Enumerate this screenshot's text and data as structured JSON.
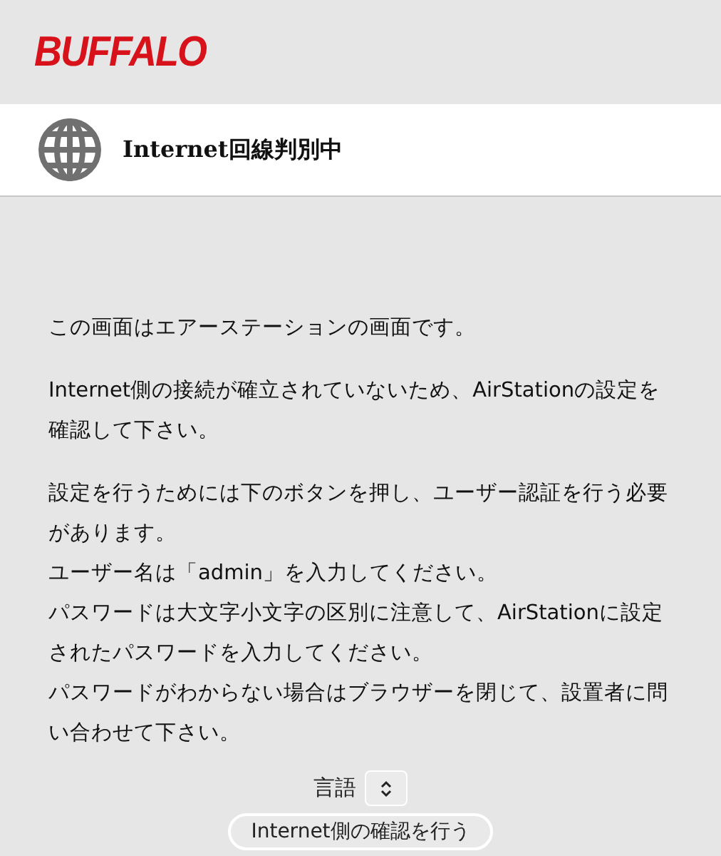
{
  "logo": "BUFFALO",
  "header": {
    "title": "Internet回線判別中"
  },
  "paragraphs": [
    [
      "この画面はエアーステーションの画面です。"
    ],
    [
      "Internet側の接続が確立されていないため、AirStationの設定を確認して下さい。"
    ],
    [
      "設定を行うためには下のボタンを押し、ユーザー認証を行う必要があります。",
      "ユーザー名は「admin」を入力してください。",
      "パスワードは大文字小文字の区別に注意して、AirStationに設定されたパスワードを入力してください。",
      "パスワードがわからない場合はブラウザーを閉じて、設置者に問い合わせて下さい。"
    ]
  ],
  "language": {
    "label": "言語"
  },
  "button": "Internet側の確認を行う"
}
